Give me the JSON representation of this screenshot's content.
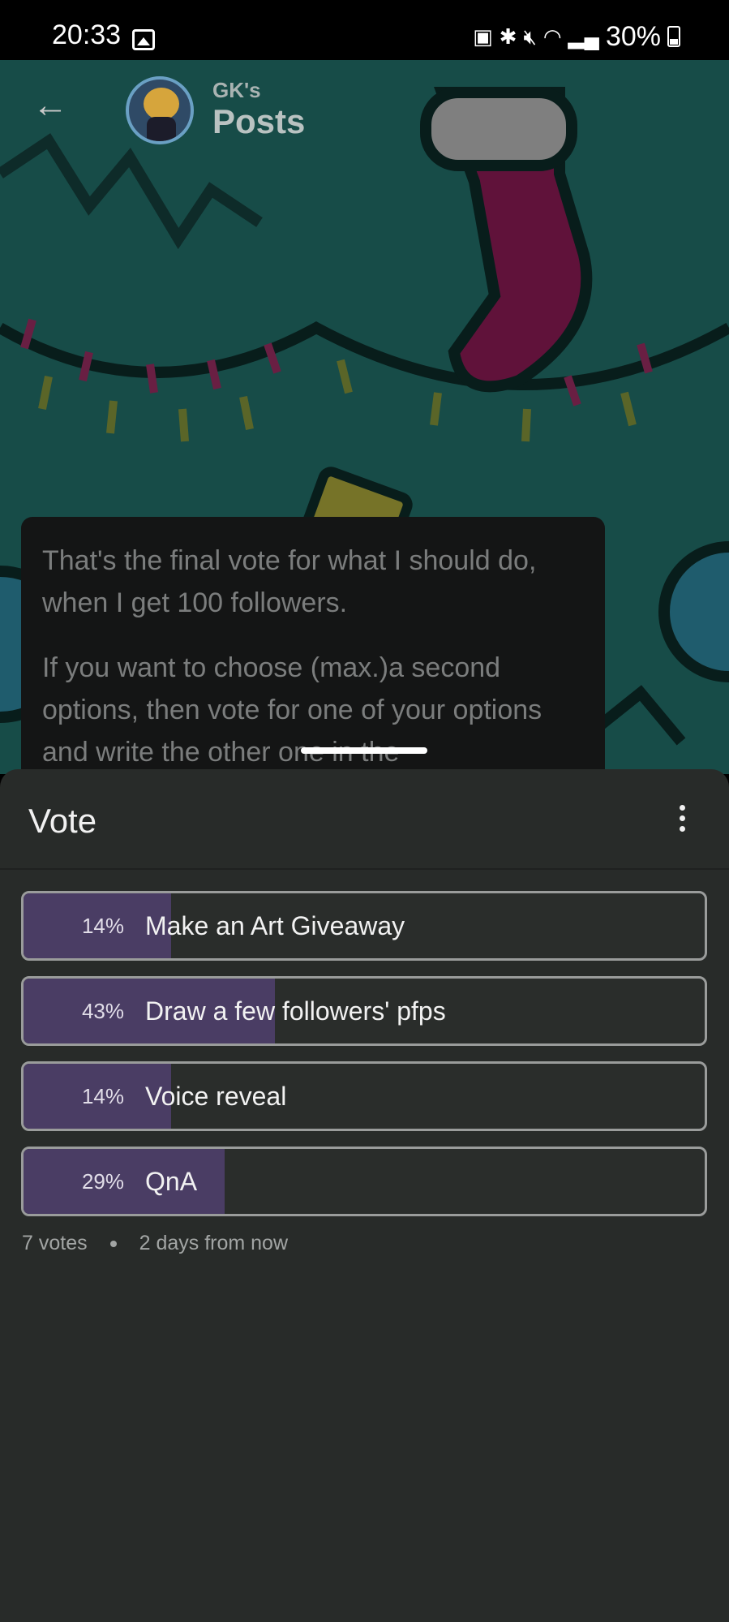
{
  "status_bar": {
    "time": "20:33",
    "battery": "30%",
    "icons": [
      "photo-icon",
      "battery-saver-icon",
      "bluetooth-icon",
      "mute-icon",
      "wifi-icon",
      "signal-icon",
      "battery-icon"
    ]
  },
  "header": {
    "subtitle": "GK's",
    "title": "Posts"
  },
  "post": {
    "paragraph_1": "That's the final vote for what I should do, when I get 100 followers.",
    "paragraph_2": "If you want to choose (max.)a second options, then vote for one of your options and write the other one in the"
  },
  "vote": {
    "title": "Vote",
    "options": [
      {
        "percent": "14%",
        "label": "Make an Art Giveaway",
        "fill": 0.14
      },
      {
        "percent": "43%",
        "label": "Draw a few followers' pfps",
        "fill": 0.43
      },
      {
        "percent": "14%",
        "label": "Voice reveal",
        "fill": 0.14
      },
      {
        "percent": "29%",
        "label": "QnA",
        "fill": 0.29
      }
    ],
    "votes": "7 votes",
    "deadline": "2 days from now"
  },
  "colors": {
    "sheet_bg": "#282b29",
    "fill": "#4a3d64",
    "accent_teal": "#2a8b84"
  }
}
